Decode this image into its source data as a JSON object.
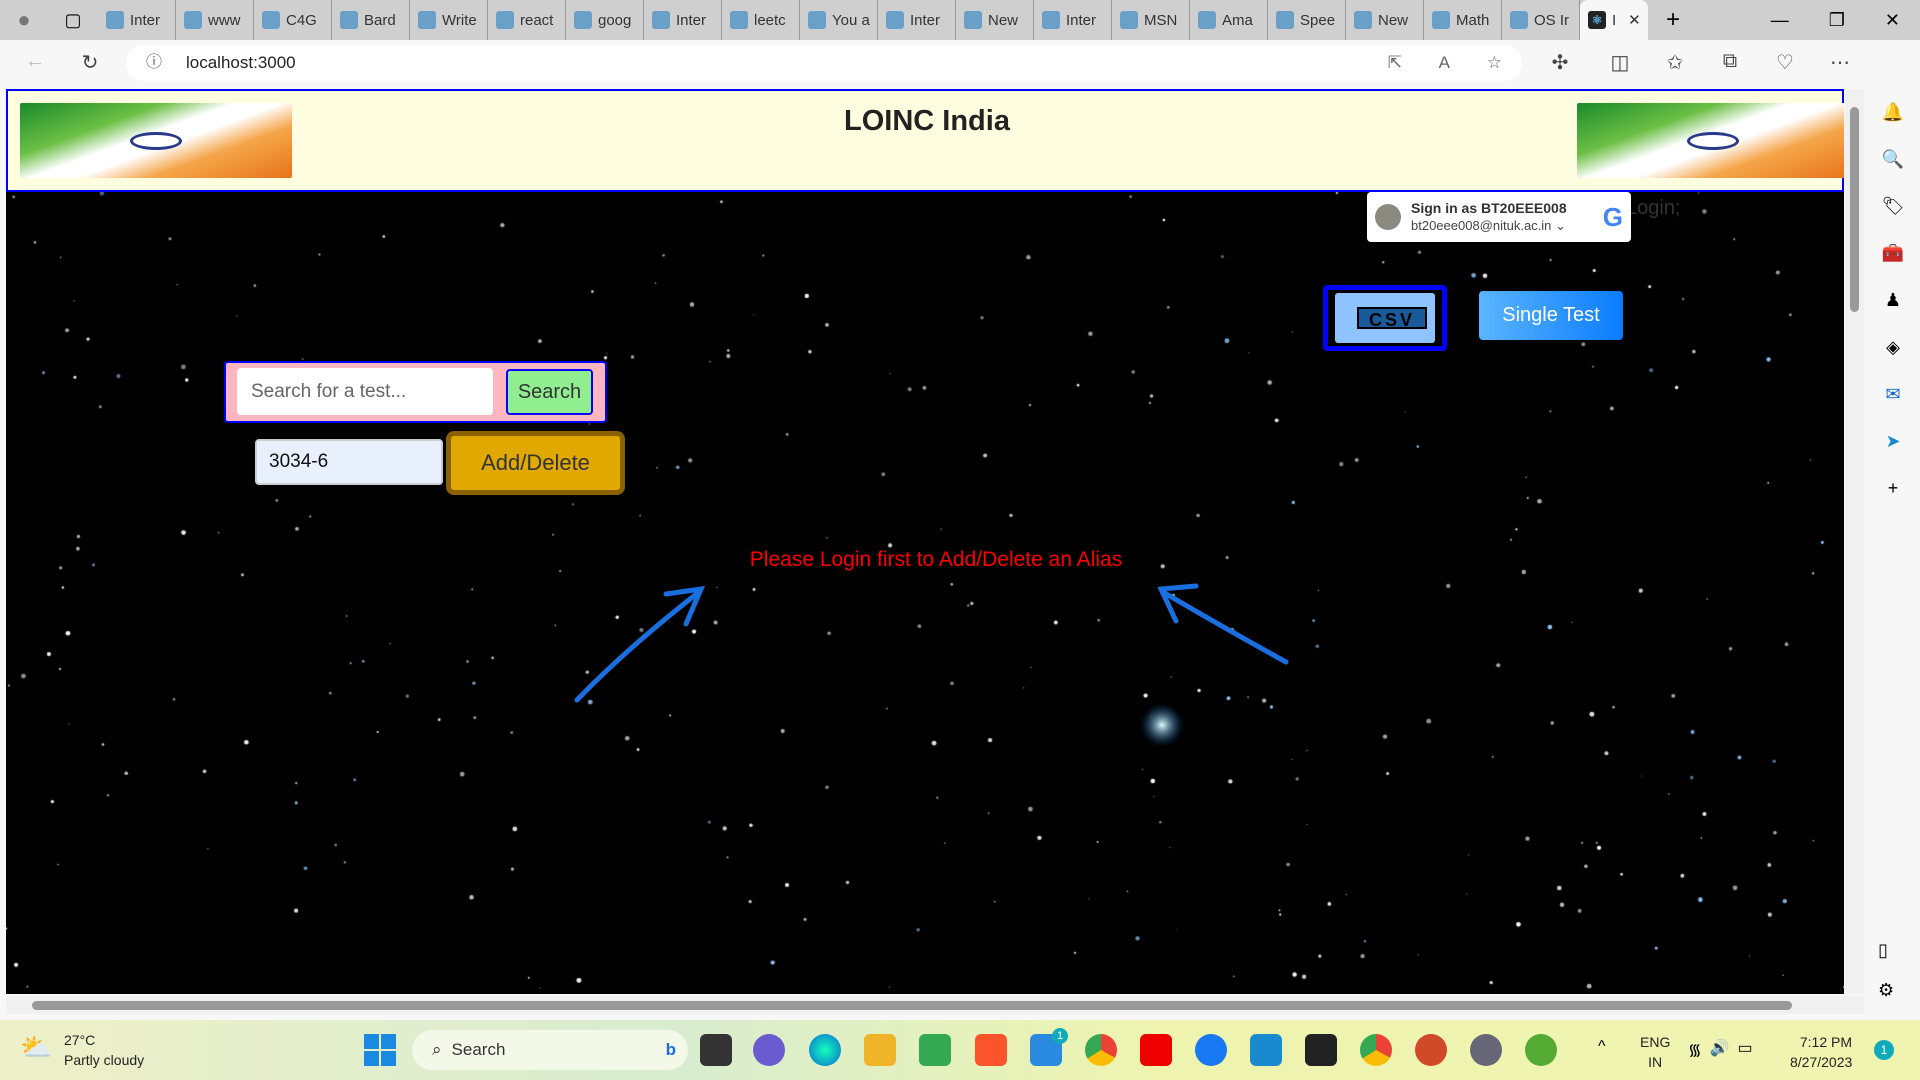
{
  "browser": {
    "tabs": [
      {
        "label": "Inter",
        "icon": "s-icon"
      },
      {
        "label": "www",
        "icon": "doc-icon"
      },
      {
        "label": "C4G",
        "icon": "chatgpt-icon"
      },
      {
        "label": "Bard",
        "icon": "bard-icon"
      },
      {
        "label": "Write",
        "icon": "doc-icon"
      },
      {
        "label": "react",
        "icon": "stackoverflow-icon"
      },
      {
        "label": "goog",
        "icon": "doc-icon"
      },
      {
        "label": "Inter",
        "icon": "s-icon"
      },
      {
        "label": "leetc",
        "icon": "doc-icon"
      },
      {
        "label": "You a",
        "icon": "s-icon"
      },
      {
        "label": "Inter",
        "icon": "s-icon"
      },
      {
        "label": "New",
        "icon": "newtab-icon"
      },
      {
        "label": "Inter",
        "icon": "s-icon"
      },
      {
        "label": "MSN",
        "icon": "msn-icon"
      },
      {
        "label": "Ama",
        "icon": "amazon-icon"
      },
      {
        "label": "Spee",
        "icon": "pdf-icon"
      },
      {
        "label": "New",
        "icon": "newtab-icon"
      },
      {
        "label": "Math",
        "icon": "search-icon"
      },
      {
        "label": "OS Ir",
        "icon": "pdf-icon"
      }
    ],
    "active_tab": {
      "label": "I",
      "icon": "react-icon"
    },
    "url": "localhost:3000"
  },
  "page": {
    "title": "LOINC India",
    "signin": {
      "line1": "Sign in as BT20EEE008",
      "line2": "bt20eee008@nituk.ac.in"
    },
    "login_text": "Login;",
    "csv_label": "CSV",
    "single_test_label": "Single Test",
    "search_placeholder": "Search for a test...",
    "search_button": "Search",
    "alias_value": "3034-6",
    "add_delete_button": "Add/Delete",
    "message": "Please Login first to Add/Delete an Alias",
    "colors": {
      "message": "#ff0000",
      "header_border": "#0000ff",
      "search_btn": "#90ee90",
      "add_btn": "#e0a800"
    }
  },
  "taskbar": {
    "weather": {
      "temp": "27°C",
      "desc": "Partly cloudy"
    },
    "search_label": "Search",
    "lang1": "ENG",
    "lang2": "IN",
    "time": "7:12 PM",
    "date": "8/27/2023",
    "notification_count": "1",
    "mail_badge": "1"
  }
}
